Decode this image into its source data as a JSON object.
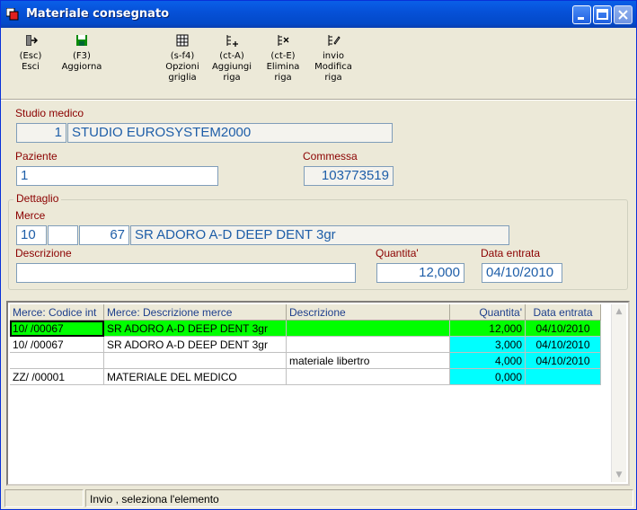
{
  "window": {
    "title": "Materiale consegnato"
  },
  "toolbar": [
    {
      "key": "(Esc)",
      "label": "Esci",
      "icon": "exit-icon"
    },
    {
      "key": "(F3)",
      "label": "Aggiorna",
      "icon": "save-icon"
    },
    {
      "key": "(s-f4)",
      "label": "Opzioni",
      "label2": "griglia",
      "icon": "grid-options-icon"
    },
    {
      "key": "(ct-A)",
      "label": "Aggiungi",
      "label2": "riga",
      "icon": "add-row-icon"
    },
    {
      "key": "(ct-E)",
      "label": "Elimina",
      "label2": "riga",
      "icon": "delete-row-icon"
    },
    {
      "key": "invio",
      "label": "Modifica",
      "label2": "riga",
      "icon": "edit-row-icon"
    }
  ],
  "form": {
    "studio_label": "Studio medico",
    "studio_code": "1",
    "studio_name": "STUDIO EUROSYSTEM2000",
    "paziente_label": "Paziente",
    "paziente_value": "1",
    "commessa_label": "Commessa",
    "commessa_value": "103773519",
    "dettaglio_label": "Dettaglio",
    "merce_label": "Merce",
    "merce_code1": "10",
    "merce_code2": "",
    "merce_code3": "67",
    "merce_desc": "SR ADORO A-D DEEP DENT 3gr",
    "descrizione_label": "Descrizione",
    "descrizione_value": "",
    "quantita_label": "Quantita'",
    "quantita_value": "12,000",
    "data_label": "Data entrata",
    "data_value": "04/10/2010"
  },
  "grid": {
    "columns": [
      "Merce: Codice int",
      "Merce: Descrizione merce",
      "Descrizione",
      "Quantita'",
      "Data entrata"
    ],
    "rows": [
      {
        "codice": "10/ /00067",
        "desc_merce": "SR ADORO A-D DEEP DENT 3gr",
        "descrizione": "",
        "quantita": "12,000",
        "data": "04/10/2010"
      },
      {
        "codice": "10/ /00067",
        "desc_merce": "SR ADORO A-D DEEP DENT 3gr",
        "descrizione": "",
        "quantita": "3,000",
        "data": "04/10/2010"
      },
      {
        "codice": "",
        "desc_merce": "",
        "descrizione": "materiale libertro",
        "quantita": "4,000",
        "data": "04/10/2010"
      },
      {
        "codice": "ZZ/ /00001",
        "desc_merce": "MATERIALE DEL MEDICO",
        "descrizione": "",
        "quantita": "0,000",
        "data": ""
      }
    ]
  },
  "status": {
    "pane1": "",
    "pane2": "Invio , seleziona l'elemento"
  },
  "colors": {
    "title_bar": "#0A5FE8",
    "selected_row": "#00FF00",
    "highlight_cell": "#00FFFF",
    "label": "#8B0000",
    "field_text": "#1E5EA8"
  }
}
